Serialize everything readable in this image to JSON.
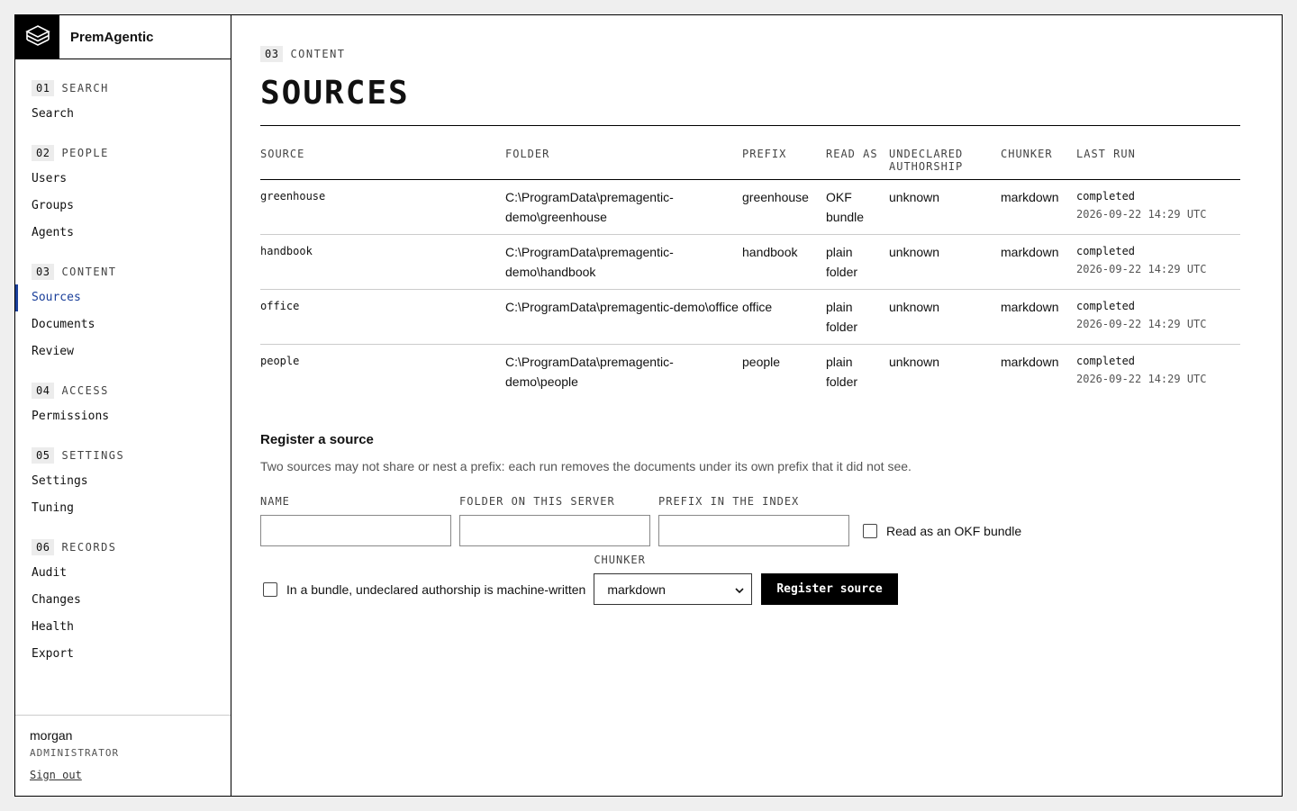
{
  "brand": {
    "name": "PremAgentic"
  },
  "nav": [
    {
      "num": "01",
      "label": "SEARCH",
      "items": [
        {
          "label": "Search"
        }
      ]
    },
    {
      "num": "02",
      "label": "PEOPLE",
      "items": [
        {
          "label": "Users"
        },
        {
          "label": "Groups"
        },
        {
          "label": "Agents"
        }
      ]
    },
    {
      "num": "03",
      "label": "CONTENT",
      "items": [
        {
          "label": "Sources",
          "active": true
        },
        {
          "label": "Documents"
        },
        {
          "label": "Review"
        }
      ]
    },
    {
      "num": "04",
      "label": "ACCESS",
      "items": [
        {
          "label": "Permissions"
        }
      ]
    },
    {
      "num": "05",
      "label": "SETTINGS",
      "items": [
        {
          "label": "Settings"
        },
        {
          "label": "Tuning"
        }
      ]
    },
    {
      "num": "06",
      "label": "RECORDS",
      "items": [
        {
          "label": "Audit"
        },
        {
          "label": "Changes"
        },
        {
          "label": "Health"
        },
        {
          "label": "Export"
        }
      ]
    }
  ],
  "user": {
    "name": "morgan",
    "role": "ADMINISTRATOR",
    "sign_out": "Sign out"
  },
  "page": {
    "section_num": "03",
    "section_label": "CONTENT",
    "title": "SOURCES"
  },
  "table": {
    "headers": [
      "SOURCE",
      "FOLDER",
      "PREFIX",
      "READ AS",
      "UNDECLARED AUTHORSHIP",
      "CHUNKER",
      "LAST RUN"
    ],
    "rows": [
      {
        "source": "greenhouse",
        "folder": "C:\\ProgramData\\premagentic-demo\\greenhouse",
        "prefix": "greenhouse",
        "read_as": "OKF bundle",
        "authorship": "unknown",
        "chunker": "markdown",
        "status": "completed",
        "time": "2026-09-22 14:29 UTC"
      },
      {
        "source": "handbook",
        "folder": "C:\\ProgramData\\premagentic-demo\\handbook",
        "prefix": "handbook",
        "read_as": "plain folder",
        "authorship": "unknown",
        "chunker": "markdown",
        "status": "completed",
        "time": "2026-09-22 14:29 UTC"
      },
      {
        "source": "office",
        "folder": "C:\\ProgramData\\premagentic-demo\\office",
        "prefix": "office",
        "read_as": "plain folder",
        "authorship": "unknown",
        "chunker": "markdown",
        "status": "completed",
        "time": "2026-09-22 14:29 UTC"
      },
      {
        "source": "people",
        "folder": "C:\\ProgramData\\premagentic-demo\\people",
        "prefix": "people",
        "read_as": "plain folder",
        "authorship": "unknown",
        "chunker": "markdown",
        "status": "completed",
        "time": "2026-09-22 14:29 UTC"
      }
    ]
  },
  "register": {
    "title": "Register a source",
    "note": "Two sources may not share or nest a prefix: each run removes the documents under its own prefix that it did not see.",
    "name_label": "NAME",
    "folder_label": "FOLDER ON THIS SERVER",
    "prefix_label": "PREFIX IN THE INDEX",
    "okf_checkbox": "Read as an OKF bundle",
    "machine_checkbox": "In a bundle, undeclared authorship is machine-written",
    "chunker_label": "CHUNKER",
    "chunker_value": "markdown",
    "submit": "Register source"
  }
}
